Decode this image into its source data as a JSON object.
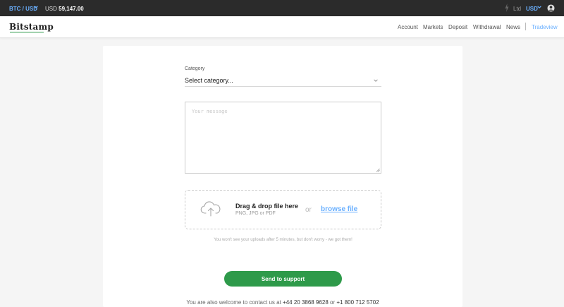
{
  "topbar": {
    "pair": "BTC / USD",
    "price_prefix": "USD",
    "price_value": "59,147.00",
    "ltd": "Ltd",
    "currency": "USD"
  },
  "navbar": {
    "logo": "Bitstamp",
    "items": [
      "Account",
      "Markets",
      "Deposit",
      "Withdrawal",
      "News"
    ],
    "tradeview": "Tradeview"
  },
  "form": {
    "category_label": "Category",
    "category_value": "Select category...",
    "message_placeholder": "Your message",
    "drop_title": "Drag & drop file here",
    "drop_sub": "PNG, JPG or PDF",
    "or": "or",
    "browse": "browse file",
    "note": "You won't see your uploads after 5 minutes, but don't worry - we got them!",
    "send_label": "Send to support"
  },
  "contact": {
    "text": "You are also welcome to contact us at",
    "phone1": "+44 20 3868 9628",
    "or": "or",
    "phone2": "+1 800 712 5702"
  },
  "colors": {
    "accent_blue": "#6ab0ff",
    "brand_green": "#2e9a4a",
    "topbar_bg": "#2b2b2b"
  }
}
